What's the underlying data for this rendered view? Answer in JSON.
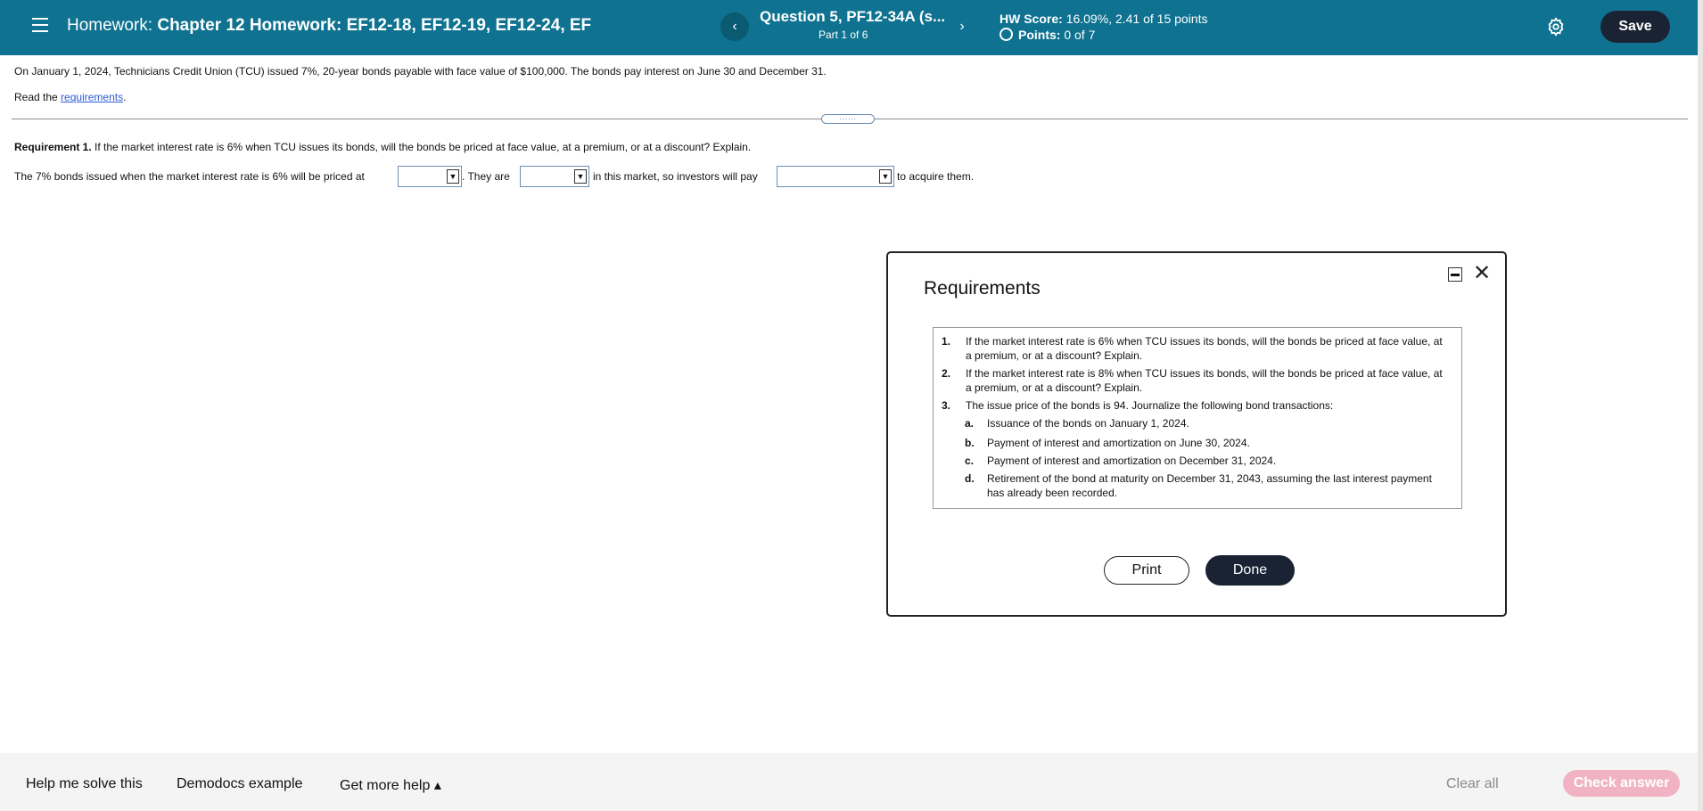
{
  "header": {
    "homework_prefix": "Homework: ",
    "homework_title": "Chapter 12 Homework: EF12-18, EF12-19, EF12-24, EF",
    "question_title": "Question 5, PF12-34A (s...",
    "part": "Part 1 of 6",
    "hw_score_label": "HW Score:",
    "hw_score_value": "16.09%, 2.41 of 15 points",
    "points_label": "Points:",
    "points_value": "0 of 7",
    "prev_icon": "‹",
    "next_icon": "›",
    "save_label": "Save"
  },
  "question": {
    "intro": "On January 1, 2024, Technicians Credit Union (TCU) issued 7%, 20-year bonds payable with face value of $100,000. The bonds pay interest on June 30 and December 31.",
    "read_prefix": "Read the ",
    "read_link": "requirements",
    "read_suffix": ".",
    "drag_dots": "......",
    "req1_label": "Requirement 1.",
    "req1_text": " If the market interest rate is 6% when TCU issues its bonds, will the bonds be priced at face value, at a premium, or at a discount? Explain.",
    "answer_part1": "The 7% bonds issued when the market interest rate is 6% will be priced at",
    "answer_part2": ". They are",
    "answer_part3": "in this market, so investors will pay",
    "answer_part4": "to acquire them.",
    "dropdown_values": [
      "",
      "",
      ""
    ],
    "caret_icon": "▼"
  },
  "modal": {
    "title": "Requirements",
    "close_icon": "✕",
    "items": [
      {
        "num": "1.",
        "text": "If the market interest rate is 6% when TCU issues its bonds, will the bonds be priced at face value, at a premium, or at a discount? Explain."
      },
      {
        "num": "2.",
        "text": "If the market interest rate is 8% when TCU issues its bonds, will the bonds be priced at face value, at a premium, or at a discount? Explain."
      },
      {
        "num": "3.",
        "text": "The issue price of the bonds is 94. Journalize the following bond transactions:"
      }
    ],
    "subitems": [
      {
        "num": "a.",
        "text": "Issuance of the bonds on January 1, 2024."
      },
      {
        "num": "b.",
        "text": "Payment of interest and amortization on June 30, 2024."
      },
      {
        "num": "c.",
        "text": "Payment of interest and amortization on December 31, 2024."
      },
      {
        "num": "d.",
        "text": "Retirement of the bond at maturity on December 31, 2043, assuming the last interest payment has already been recorded."
      }
    ],
    "print_label": "Print",
    "done_label": "Done"
  },
  "footer": {
    "help_label": "Help me solve this",
    "demodocs_label": "Demodocs example",
    "more_help_label": "Get more help ▴",
    "clear_all_label": "Clear all",
    "check_answer_label": "Check answer"
  },
  "colors": {
    "header_bg": "#0e7290",
    "save_button": "#1a2333",
    "check_answer_disabled": "#f1b3c4",
    "link": "#2a5bd7"
  }
}
